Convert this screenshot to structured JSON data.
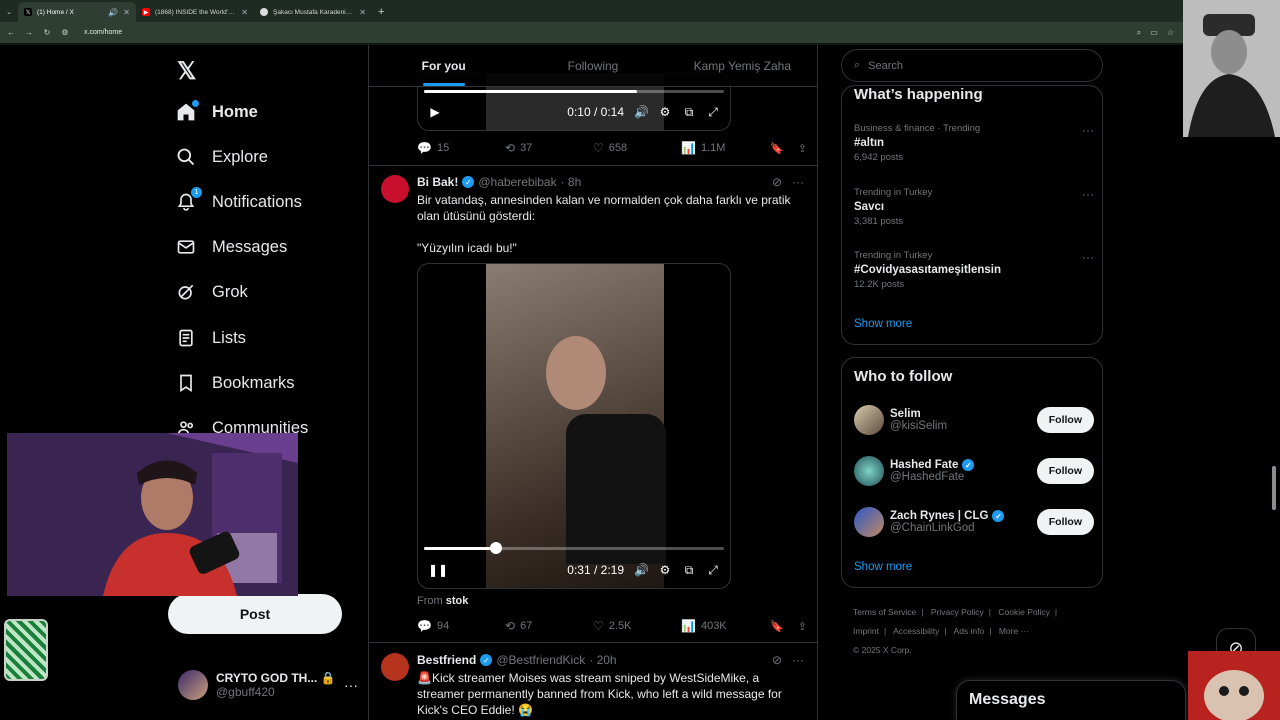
{
  "browser": {
    "tabs": [
      {
        "title": "(1) Home / X",
        "favicon": "x-icon",
        "active": true
      },
      {
        "title": "(1868) INSIDE the World's Mos",
        "favicon": "youtube-icon",
        "active": false
      },
      {
        "title": "Şakacı Mustafa Karadeniz - Bal",
        "favicon": "globe-icon",
        "active": false
      }
    ],
    "new_tab": "+",
    "url": "x.com/home"
  },
  "nav": {
    "items": [
      {
        "label": "Home",
        "icon": "home-icon"
      },
      {
        "label": "Explore",
        "icon": "search-icon"
      },
      {
        "label": "Notifications",
        "icon": "bell-icon",
        "badge": "1"
      },
      {
        "label": "Messages",
        "icon": "mail-icon"
      },
      {
        "label": "Grok",
        "icon": "grok-icon"
      },
      {
        "label": "Lists",
        "icon": "list-icon"
      },
      {
        "label": "Bookmarks",
        "icon": "bookmark-icon"
      },
      {
        "label": "Communities",
        "icon": "people-icon"
      }
    ],
    "post_label": "Post",
    "account": {
      "name": "CRYTO GOD TH...",
      "handle": "@gbuff420"
    }
  },
  "feed": {
    "tabs": [
      "For you",
      "Following",
      "Kamp Yemiş Zaha"
    ],
    "tweet1": {
      "video_time": "0:10 / 0:14",
      "progress": 0.71,
      "stats": {
        "replies": "15",
        "reposts": "37",
        "likes": "658",
        "views": "1.1M"
      }
    },
    "tweet2": {
      "name": "Bi Bak!",
      "handle": "@haberebibak",
      "time": "· 8h",
      "text_line1": "Bir vatandaş, annesinden kalan ve normalden çok daha farklı ve pratik olan ütüsünü gösterdi:",
      "text_line2": "\"Yüzyılın icadı bu!\"",
      "video_time": "0:31 / 2:19",
      "progress": 0.24,
      "from_label": "From",
      "from_source": "stok",
      "stats": {
        "replies": "94",
        "reposts": "67",
        "likes": "2.5K",
        "views": "403K"
      }
    },
    "tweet3": {
      "name": "Bestfriend",
      "handle": "@BestfriendKick",
      "time": "· 20h",
      "text": "🚨Kick streamer Moises was stream sniped by WestSideMike, a streamer permanently banned from Kick, who left a wild message for Kick's CEO Eddie! 😭"
    }
  },
  "sidebar": {
    "search_placeholder": "Search",
    "happening_title": "What’s happening",
    "trends": [
      {
        "category": "Business & finance · Trending",
        "title": "#altın",
        "count": "6,942 posts"
      },
      {
        "category": "Trending in Turkey",
        "title": "Savcı",
        "count": "3,381 posts"
      },
      {
        "category": "Trending in Turkey",
        "title": "#Covidyasasıtameşitlensin",
        "count": "12.2K posts"
      }
    ],
    "show_more": "Show more",
    "wtf_title": "Who to follow",
    "who_to_follow": [
      {
        "name": "Selim",
        "handle": "@kisiSelim",
        "verified": false,
        "button": "Follow"
      },
      {
        "name": "Hashed Fate",
        "handle": "@HashedFate",
        "verified": true,
        "button": "Follow"
      },
      {
        "name": "Zach Rynes | CLG",
        "handle": "@ChainLinkGod",
        "verified": true,
        "button": "Follow"
      }
    ],
    "wtf_show_more": "Show more",
    "footer": [
      "Terms of Service",
      "|",
      "Privacy Policy",
      "|",
      "Cookie Policy",
      "|",
      "Imprint",
      "|",
      "Accessibility",
      "|",
      "Ads info",
      "|",
      "More ···",
      "© 2025 X Corp."
    ],
    "messages_label": "Messages"
  },
  "colors": {
    "accent": "#1d9bf0",
    "background": "#000000",
    "border": "#2f3336",
    "muted": "#71767b"
  }
}
